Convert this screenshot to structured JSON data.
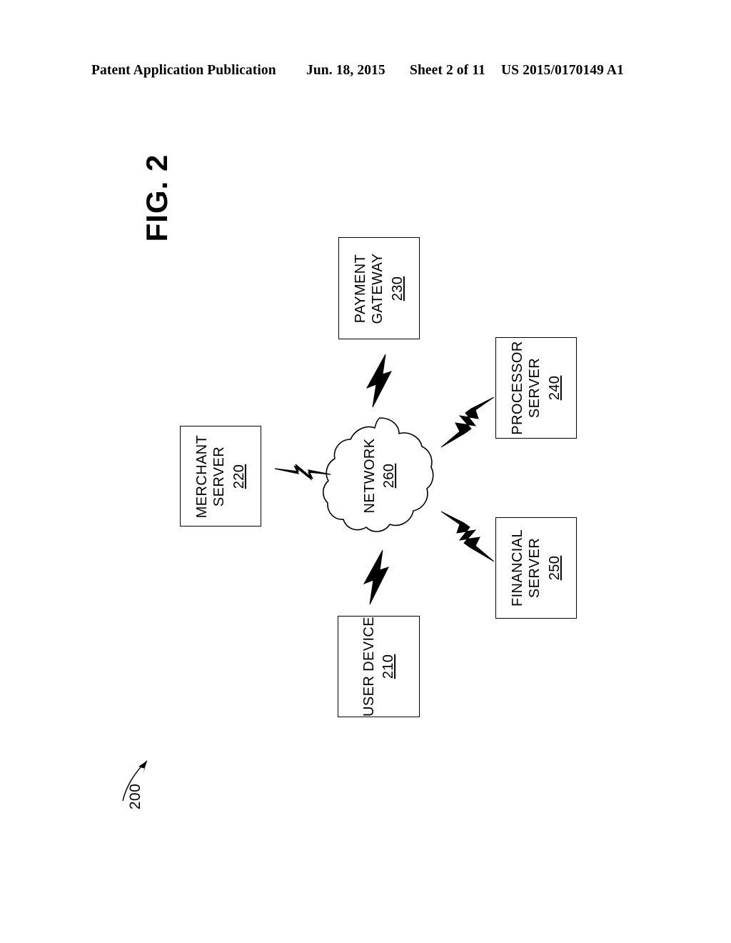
{
  "header": {
    "publication": "Patent Application Publication",
    "date": "Jun. 18, 2015",
    "sheet": "Sheet 2 of 11",
    "doc_number": "US 2015/0170149 A1"
  },
  "figure": {
    "label": "FIG. 2",
    "system_ref": "200"
  },
  "nodes": {
    "payment_gateway": {
      "line1": "PAYMENT",
      "line2": "GATEWAY",
      "ref": "230"
    },
    "processor_server": {
      "line1": "PROCESSOR",
      "line2": "SERVER",
      "ref": "240"
    },
    "merchant_server": {
      "line1": "MERCHANT",
      "line2": "SERVER",
      "ref": "220"
    },
    "financial_server": {
      "line1": "FINANCIAL",
      "line2": "SERVER",
      "ref": "250"
    },
    "user_device": {
      "line1": "USER DEVICE",
      "ref": "210"
    },
    "network": {
      "line1": "NETWORK",
      "ref": "260"
    }
  },
  "connectors": [
    {
      "name": "network-to-payment-gateway",
      "style": "lightning-bolt",
      "direction": "up"
    },
    {
      "name": "network-to-processor-server",
      "style": "lightning-bolt",
      "direction": "up-right"
    },
    {
      "name": "network-to-merchant-server",
      "style": "lightning-bolt",
      "direction": "left"
    },
    {
      "name": "network-to-financial-server",
      "style": "lightning-bolt",
      "direction": "down-right"
    },
    {
      "name": "network-to-user-device",
      "style": "lightning-bolt",
      "direction": "down"
    }
  ],
  "colors": {
    "ink": "#000000",
    "paper": "#ffffff"
  }
}
